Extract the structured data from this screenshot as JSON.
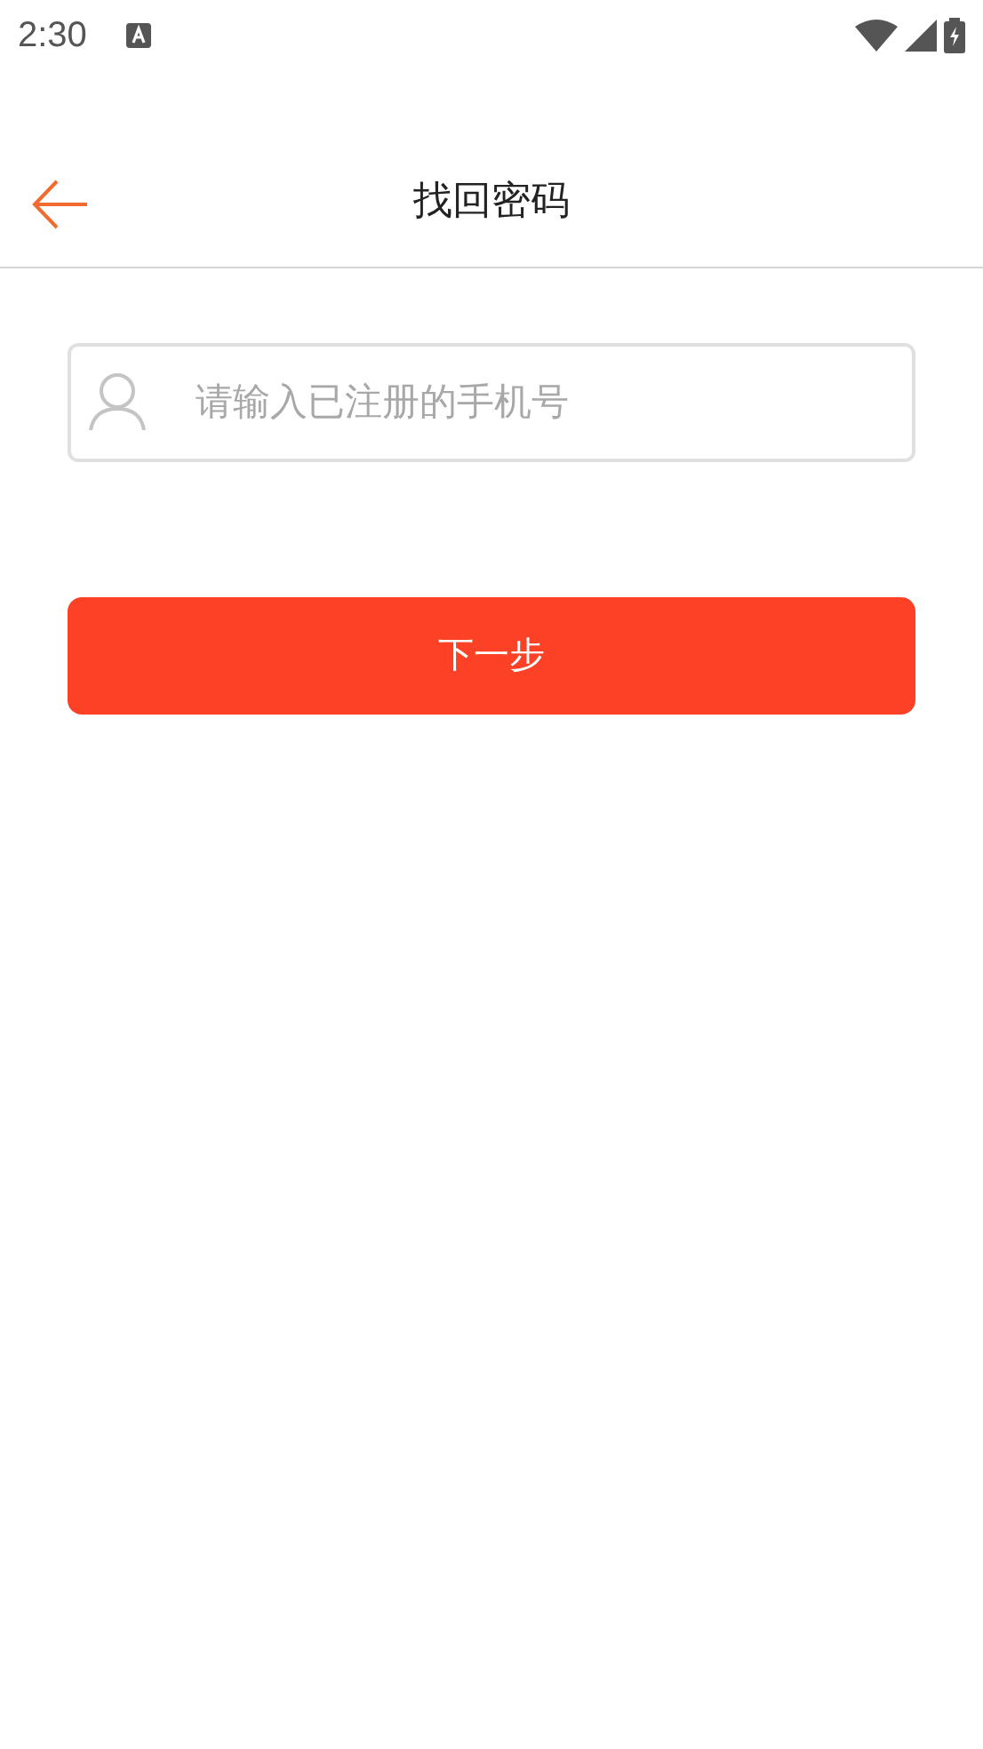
{
  "status_bar": {
    "time": "2:30"
  },
  "header": {
    "title": "找回密码"
  },
  "phone_field": {
    "placeholder": "请输入已注册的手机号"
  },
  "next_button": {
    "label": "下一步"
  }
}
